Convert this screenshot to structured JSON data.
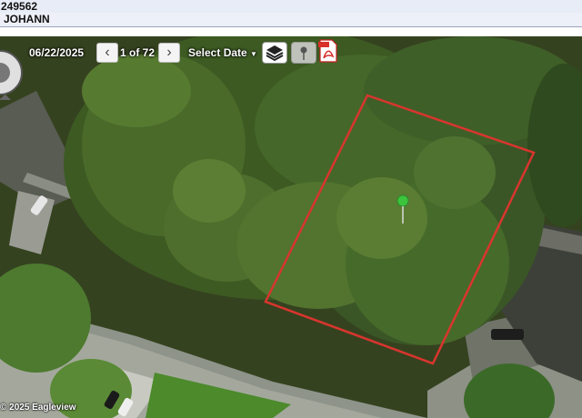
{
  "header": {
    "parcel_id": "249562",
    "owner_name": "JOHANN"
  },
  "toolbar": {
    "date": "06/22/2025",
    "prev_icon": "chevron-left-icon",
    "next_icon": "chevron-right-icon",
    "count": "1 of 72",
    "select_date_label": "Select Date",
    "layers_icon": "layers-icon",
    "pin_icon": "pin-icon",
    "pdf_icon": "pdf-icon"
  },
  "map": {
    "copyright": "© 2025 Eagleview",
    "parcel_color": "#d9352e",
    "marker_color": "#3cc43c"
  }
}
